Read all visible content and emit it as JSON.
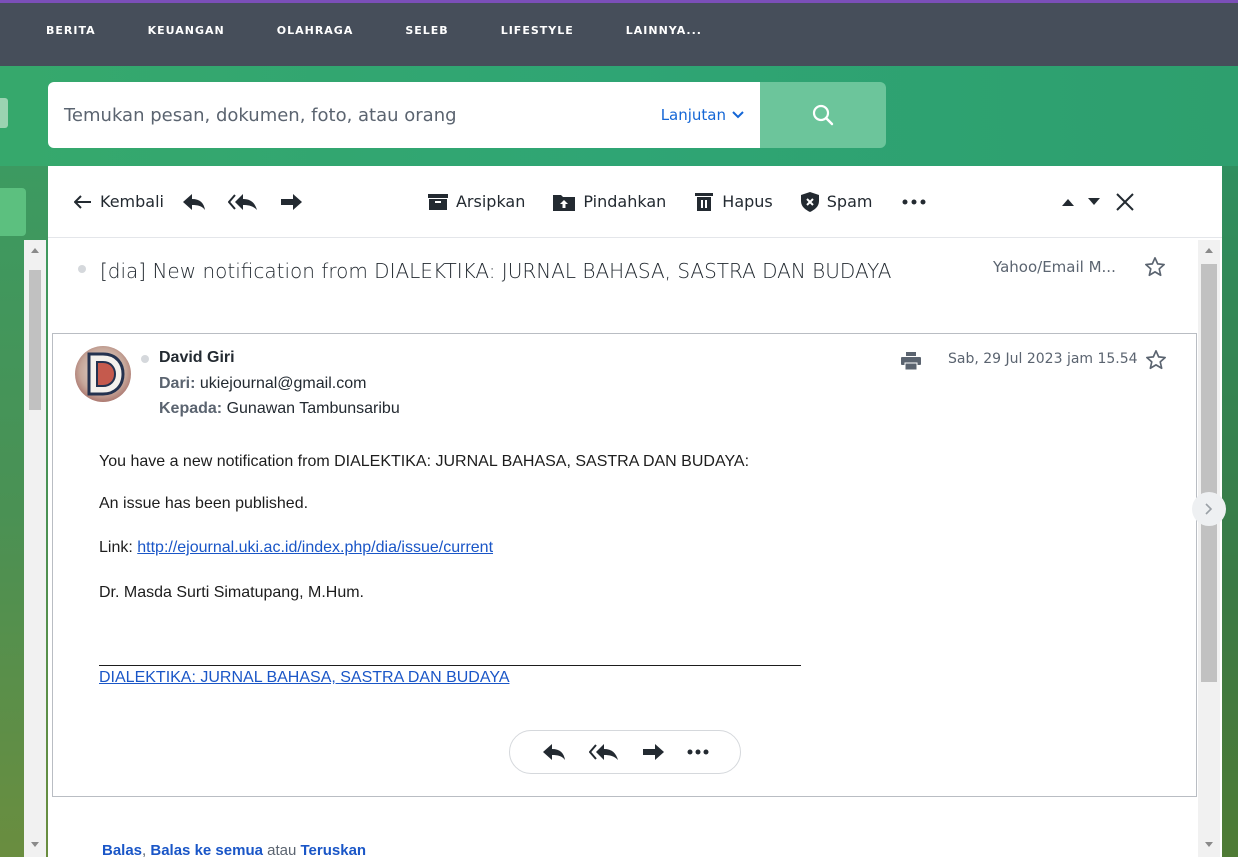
{
  "nav": {
    "items": [
      "BERITA",
      "KEUANGAN",
      "OLAHRAGA",
      "SELEB",
      "LIFESTYLE",
      "LAINNYA..."
    ]
  },
  "search": {
    "placeholder": "Temukan pesan, dokumen, foto, atau orang",
    "advanced_label": "Lanjutan"
  },
  "toolbar": {
    "back_label": "Kembali",
    "archive_label": "Arsipkan",
    "move_label": "Pindahkan",
    "delete_label": "Hapus",
    "spam_label": "Spam"
  },
  "message": {
    "subject": "[dia] New notification from DIALEKTIKA: JURNAL BAHASA, SASTRA DAN BUDAYA",
    "folder": "Yahoo/Email M...",
    "sender_name": "David Giri",
    "from_label": "Dari:",
    "from_email": "ukiejournal@gmail.com",
    "to_label": "Kepada:",
    "to_name": "Gunawan Tambunsaribu",
    "date": "Sab, 29 Jul 2023 jam 15.54",
    "body": {
      "line1": "You have a new notification from DIALEKTIKA: JURNAL BAHASA, SASTRA DAN BUDAYA:",
      "line2": "An issue has been published.",
      "link_prefix": "Link: ",
      "link_url": "http://ejournal.uki.ac.id/index.php/dia/issue/current",
      "signature": "Dr. Masda Surti Simatupang, M.Hum.",
      "footer_link": "DIALEKTIKA: JURNAL BAHASA, SASTRA DAN BUDAYA"
    }
  },
  "quick_reply": {
    "reply": "Balas",
    "reply_all": "Balas ke semua",
    "or": "atau",
    "forward": "Teruskan"
  },
  "colors": {
    "nav_bg": "#464e5a",
    "accent_green": "#2fa574",
    "link_blue": "#1a56c7",
    "search_button": "#6cc59b"
  }
}
